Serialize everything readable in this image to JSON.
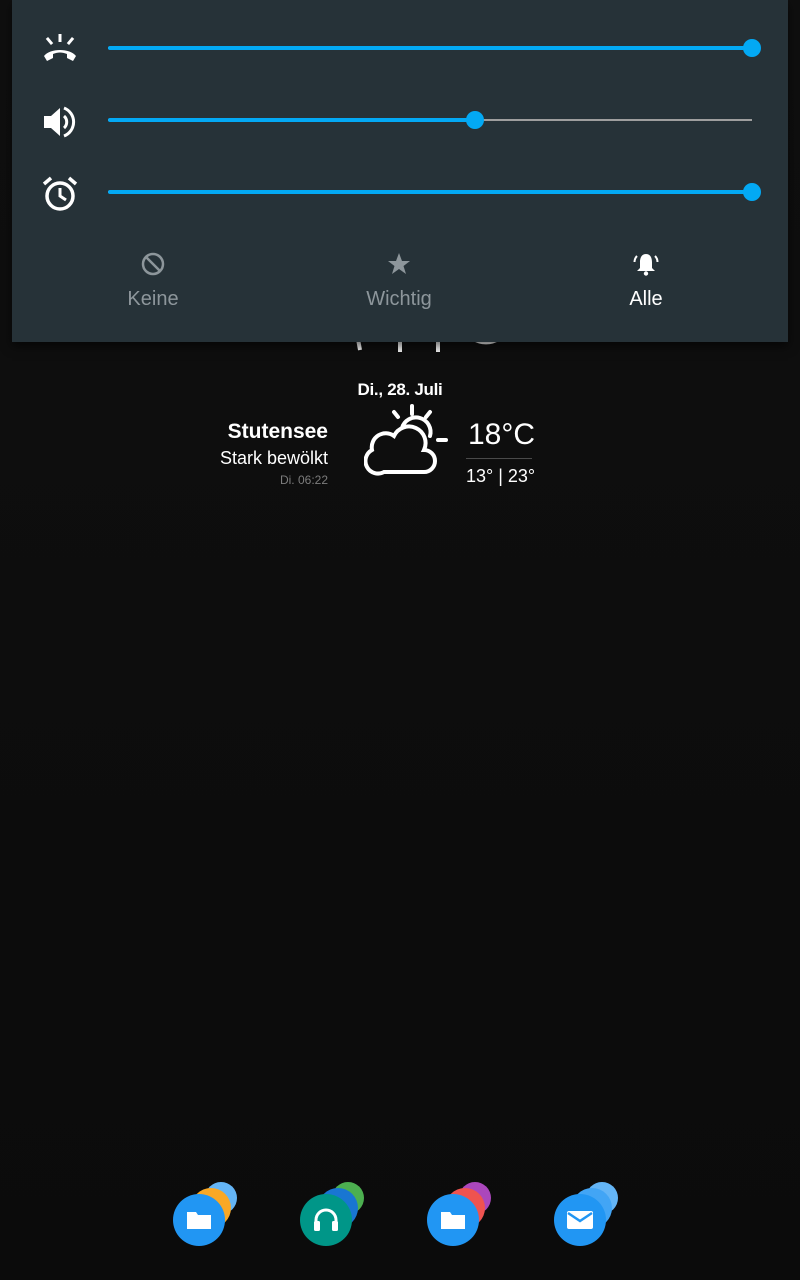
{
  "volume_panel": {
    "sliders": [
      {
        "icon": "ringer-off-phone-icon",
        "level": 1.0
      },
      {
        "icon": "speaker-volume-icon",
        "level": 0.57
      },
      {
        "icon": "alarm-clock-icon",
        "level": 1.0
      }
    ],
    "accent_color": "#03a9f4",
    "modes": [
      {
        "icon": "block-icon",
        "label": "Keine",
        "active": false
      },
      {
        "icon": "star-icon",
        "label": "Wichtig",
        "active": false
      },
      {
        "icon": "bell-icon",
        "label": "Alle",
        "active": true
      }
    ]
  },
  "weather": {
    "date": "Di., 28. Juli",
    "city": "Stutensee",
    "condition": "Stark bewölkt",
    "updated": "Di. 06:22",
    "icon": "partly-cloudy-icon",
    "temperature": "18°C",
    "range": "13° | 23°"
  },
  "dock": [
    {
      "icon": "folder-icon",
      "color": "#2196f3",
      "stack_colors": [
        "#64b5f6",
        "#f9a825"
      ]
    },
    {
      "icon": "headphones-icon",
      "color": "#009688",
      "stack_colors": [
        "#4caf50",
        "#1976d2"
      ]
    },
    {
      "icon": "folder-icon",
      "color": "#2196f3",
      "stack_colors": [
        "#ab47bc",
        "#ef5350"
      ]
    },
    {
      "icon": "mail-icon",
      "color": "#2196f3",
      "stack_colors": [
        "#64b5f6",
        "#42a5f5"
      ]
    }
  ]
}
